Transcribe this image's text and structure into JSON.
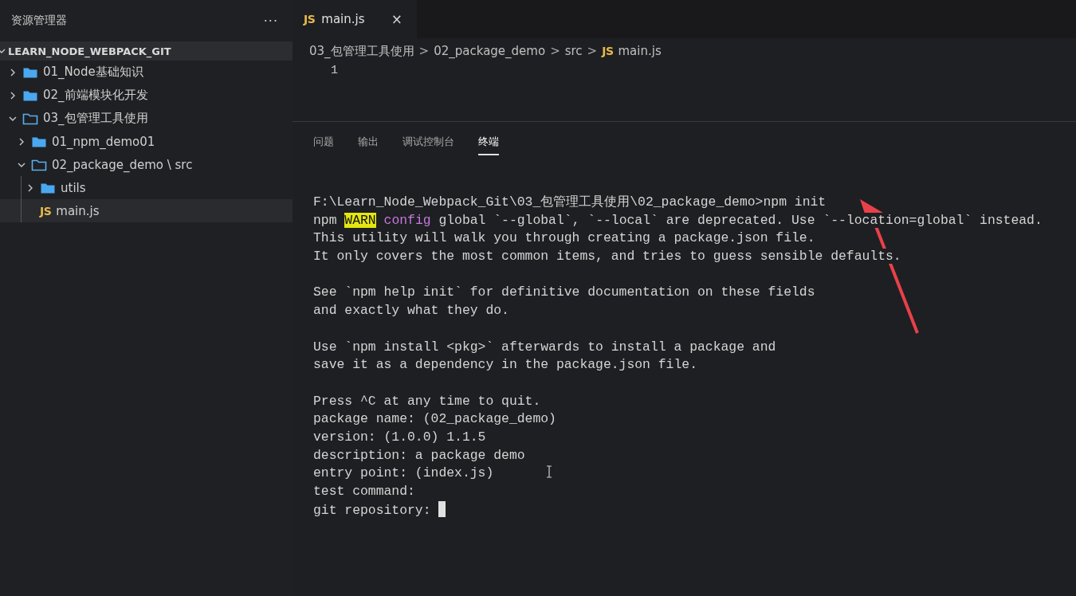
{
  "sidebar": {
    "title": "资源管理器",
    "more": "···",
    "root": {
      "label": "LEARN_NODE_WEBPACK_GIT",
      "expanded": true
    },
    "tree": [
      {
        "kind": "folder",
        "name": "01_Node基础知识",
        "expanded": false,
        "selected": false
      },
      {
        "kind": "folder",
        "name": "02_前端模块化开发",
        "expanded": false,
        "selected": false
      },
      {
        "kind": "folder",
        "name": "03_包管理工具使用",
        "expanded": true,
        "selected": false,
        "children": [
          {
            "kind": "folder",
            "name": "01_npm_demo01",
            "expanded": false,
            "selected": false
          },
          {
            "kind": "folder",
            "name": "02_package_demo",
            "separator": "\\",
            "compact": "src",
            "expanded": true,
            "selected": false,
            "children": [
              {
                "kind": "folder",
                "name": "utils",
                "expanded": false,
                "selected": false
              },
              {
                "kind": "file",
                "badge": "JS",
                "name": "main.js",
                "selected": true
              }
            ]
          }
        ]
      }
    ]
  },
  "editor": {
    "tabs": [
      {
        "badge": "JS",
        "label": "main.js",
        "close": "×",
        "selected": true
      }
    ],
    "breadcrumb": [
      {
        "text": "03_包管理工具使用"
      },
      {
        "text": "02_package_demo"
      },
      {
        "text": "src"
      },
      {
        "badge": "JS",
        "text": "main.js"
      }
    ],
    "separator": ">",
    "line_numbers": [
      "1"
    ]
  },
  "panel": {
    "tabs": [
      {
        "label": "问题",
        "selected": false
      },
      {
        "label": "输出",
        "selected": false
      },
      {
        "label": "调试控制台",
        "selected": false
      },
      {
        "label": "终端",
        "selected": true
      }
    ],
    "terminal": [
      {
        "lines": [
          [
            {
              "kind": "plain",
              "text": "F:\\Learn_Node_Webpack_Git\\03_包管理工具使用\\02_package_demo>npm init"
            }
          ],
          [
            {
              "kind": "plain",
              "text": "npm "
            },
            {
              "kind": "warn",
              "text": "WARN"
            },
            {
              "kind": "keyword",
              "text": " config"
            },
            {
              "kind": "plain",
              "text": " global `--global`, `--local` are deprecated. Use `--location=global` instead."
            }
          ],
          [
            {
              "kind": "plain",
              "text": "This utility will walk you through creating a package.json file."
            }
          ],
          [
            {
              "kind": "plain",
              "text": "It only covers the most common items, and tries to guess sensible defaults."
            }
          ]
        ]
      },
      {
        "lines": [
          [
            {
              "kind": "plain",
              "text": "See `npm help init` for definitive documentation on these fields"
            }
          ],
          [
            {
              "kind": "plain",
              "text": "and exactly what they do."
            }
          ]
        ]
      },
      {
        "lines": [
          [
            {
              "kind": "plain",
              "text": "Use `npm install <pkg>` afterwards to install a package and"
            }
          ],
          [
            {
              "kind": "plain",
              "text": "save it as a dependency in the package.json file."
            }
          ]
        ]
      },
      {
        "lines": [
          [
            {
              "kind": "plain",
              "text": "Press ^C at any time to quit."
            }
          ],
          [
            {
              "kind": "plain",
              "text": "package name: (02_package_demo)"
            }
          ],
          [
            {
              "kind": "plain",
              "text": "version: (1.0.0) 1.1.5"
            }
          ],
          [
            {
              "kind": "plain",
              "text": "description: a package demo"
            }
          ],
          [
            {
              "kind": "plain",
              "text": "entry point: (index.js)"
            }
          ],
          [
            {
              "kind": "plain",
              "text": "test command:"
            }
          ],
          [
            {
              "kind": "plain",
              "text": "git repository: "
            },
            {
              "kind": "cursor"
            }
          ]
        ]
      }
    ]
  }
}
